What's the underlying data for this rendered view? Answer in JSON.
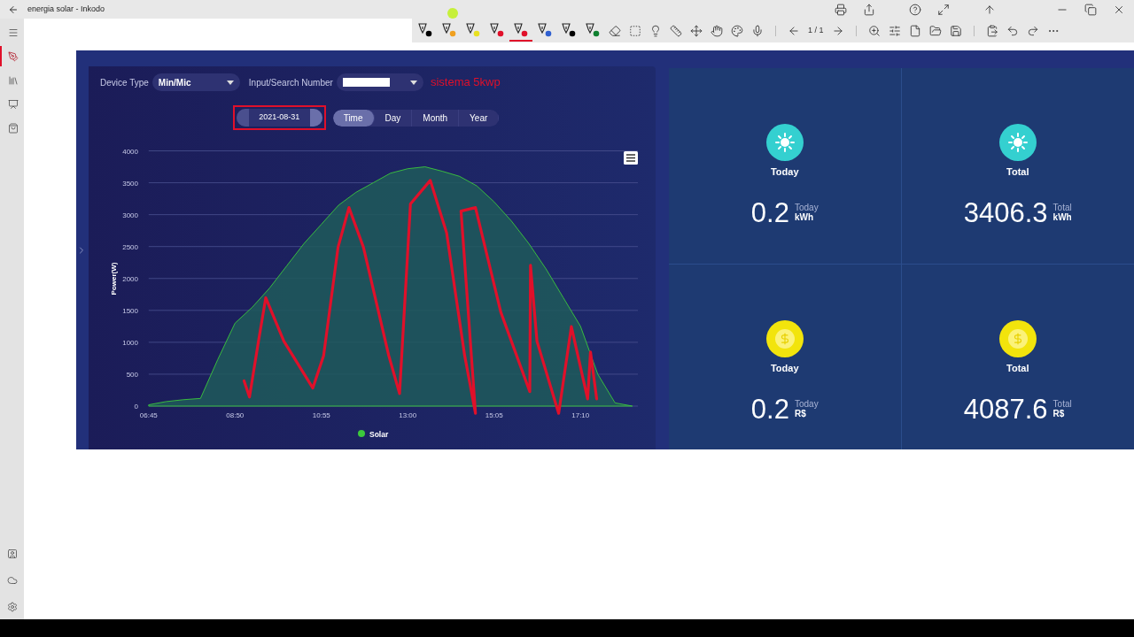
{
  "window": {
    "title": "energia solar - Inkodo"
  },
  "toolbar": {
    "pens": [
      {
        "color": "#000000",
        "selected": false
      },
      {
        "color": "#f0a020",
        "selected": false
      },
      {
        "color": "#e8e020",
        "selected": false
      },
      {
        "color": "#e0102a",
        "selected": false
      },
      {
        "color": "#e0102a",
        "selected": true
      },
      {
        "color": "#3060d0",
        "selected": false
      },
      {
        "color": "#000000",
        "selected": false
      },
      {
        "color": "#108030",
        "selected": false
      }
    ],
    "page_counter": "1 / 1"
  },
  "sidebar": {
    "items": [
      {
        "kind": "menu",
        "selected": false
      },
      {
        "kind": "pen",
        "selected": true
      },
      {
        "kind": "library",
        "selected": false
      },
      {
        "kind": "slides",
        "selected": false
      },
      {
        "kind": "bag",
        "selected": false
      }
    ],
    "bottom_items": [
      {
        "kind": "person"
      },
      {
        "kind": "cloud"
      },
      {
        "kind": "settings"
      }
    ]
  },
  "dashboard": {
    "device_type_label": "Device Type",
    "device_type": "Min/Mic",
    "search_label": "Input/Search Number",
    "annotation_text": "sistema 5kwp",
    "date": "2021-08-31",
    "tabs": [
      {
        "label": "Time",
        "selected": true
      },
      {
        "label": "Day",
        "selected": false
      },
      {
        "label": "Month",
        "selected": false
      },
      {
        "label": "Year",
        "selected": false
      }
    ],
    "chart_data": {
      "type": "area",
      "ylabel": "Power(W)",
      "x": [
        405,
        430,
        455,
        480,
        505,
        530,
        555,
        580,
        605,
        630,
        655,
        680,
        705,
        730,
        755,
        780,
        805,
        830,
        855,
        880,
        905,
        930,
        955,
        980,
        1005,
        1030,
        1055,
        1080,
        1105
      ],
      "series": [
        {
          "name": "Solar",
          "color": "#3cc83c",
          "values": [
            20,
            70,
            100,
            120,
            730,
            1300,
            1550,
            1850,
            2200,
            2550,
            2850,
            3150,
            3350,
            3500,
            3650,
            3720,
            3750,
            3680,
            3600,
            3450,
            3200,
            2900,
            2550,
            2150,
            1700,
            1250,
            500,
            50,
            0
          ]
        }
      ],
      "xlim": [
        405,
        1113
      ],
      "ylim": [
        0,
        4000
      ],
      "grid": true,
      "yticks": [
        0,
        500,
        1000,
        1500,
        2000,
        2500,
        3000,
        3500,
        4000
      ],
      "xticks": [
        {
          "value": 405,
          "label": "06:45"
        },
        {
          "value": 530,
          "label": "08:50"
        },
        {
          "value": 655,
          "label": "10:55"
        },
        {
          "value": 780,
          "label": "13:00"
        },
        {
          "value": 905,
          "label": "15:05"
        },
        {
          "value": 1030,
          "label": "17:10"
        }
      ]
    },
    "stats": [
      {
        "kind": "energy",
        "label": "Today",
        "value": "0.2",
        "unit_label": "Today",
        "unit": "kWh"
      },
      {
        "kind": "energy",
        "label": "Total",
        "value": "3406.3",
        "unit_label": "Total",
        "unit": "kWh"
      },
      {
        "kind": "money",
        "label": "Today",
        "value": "0.2",
        "unit_label": "Today",
        "unit": "R$"
      },
      {
        "kind": "money",
        "label": "Total",
        "value": "4087.6",
        "unit_label": "Total",
        "unit": "R$"
      }
    ]
  }
}
